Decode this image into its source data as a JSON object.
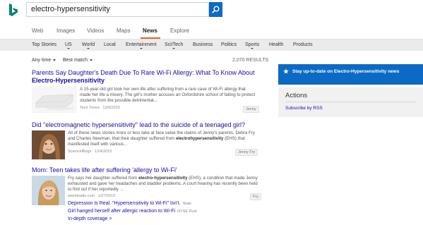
{
  "search": {
    "query": "electro-hypersensitivity"
  },
  "scopes": [
    "Web",
    "Images",
    "Videos",
    "Maps",
    "News",
    "Explore"
  ],
  "active_scope": "News",
  "categories": [
    {
      "label": "Top Stories",
      "dropdown": false
    },
    {
      "label": "US",
      "dropdown": true
    },
    {
      "label": "World",
      "dropdown": true
    },
    {
      "label": "Local",
      "dropdown": false
    },
    {
      "label": "Entertainment",
      "dropdown": true
    },
    {
      "label": "Sci/Tech",
      "dropdown": true
    },
    {
      "label": "Business",
      "dropdown": false
    },
    {
      "label": "Politics",
      "dropdown": false
    },
    {
      "label": "Sports",
      "dropdown": true
    },
    {
      "label": "Health",
      "dropdown": false
    },
    {
      "label": "Products",
      "dropdown": false
    }
  ],
  "filters": {
    "time": "Any time",
    "sort": "Best match"
  },
  "results_count": "2,070 RESULTS",
  "results": [
    {
      "title_plain": "Parents Say Daughter's Death Due To Rare Wi-Fi Allergy: What To Know About",
      "title_bold": "Electro-Hypersensitivity",
      "snippet_plain": "A 15-year-old girl took her own life after suffering from a rare case of Wi-Fi allergy that made her life a misery. The girl's mother accuses an Oxfordshire school of failing to protect students from the possible detrimental...",
      "source": "Tech Times",
      "date": "12/6/2015",
      "tag": "Jenny"
    },
    {
      "title_plain": "Did \"electromagnetic hypersensitivity\" lead to the suicide of a teenaged girl?",
      "snippet_before": "All of these news stories more or less take at face value the claims of Jenny's parents, Debra Fry and Charles Newman, that their daughter suffered from ",
      "snippet_bold": "electrohypersensitivity",
      "snippet_after": " (EHS) that manifested itself with various...",
      "source": "ScienceBlogs",
      "date": "12/4/2015",
      "tag": "Jenny Fry"
    },
    {
      "title_plain": "Mom: Teen takes life after suffering 'allergy to Wi-Fi'",
      "snippet_before": "Fry says her daughter suffered from ",
      "snippet_bold": "electro-hypersensitivity",
      "snippet_after": " (EHS), a condition that made Jenny exhausted and gave her headaches and bladder problems. A court hearing has recently been held to find out if her reportedly ...",
      "source": "wwmtradio.com",
      "date": "12/7/2015",
      "tag": "Fry",
      "sub_links": [
        {
          "text": "Depression Is Real. \"Hypersensitivity to Wi-Fi\" Isn't.",
          "source": "Slate"
        },
        {
          "text": "Girl hanged herself after allergic reaction to Wi-Fi",
          "source": "NYSE Post"
        },
        {
          "text": "In-depth coverage >",
          "source": ""
        }
      ]
    }
  ],
  "promo": {
    "text": "Stay up-to-date on Electro-Hypersensitivity news"
  },
  "actions": {
    "title": "Actions",
    "link": "Subscribe by RSS"
  },
  "colors": {
    "accent": "#0c6ac4",
    "link": "#1a0dab",
    "active_tab_underline": "#e2652a"
  },
  "icons": {
    "logo": "bing-logo-icon",
    "search": "search-icon",
    "promo": "star-icon"
  }
}
